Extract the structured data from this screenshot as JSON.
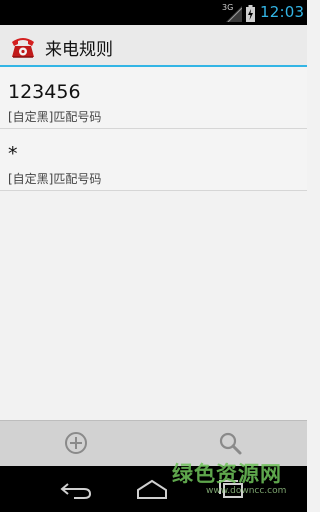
{
  "status_bar": {
    "network": "3G",
    "time": "12:03",
    "accent_color": "#33b5e5"
  },
  "action_bar": {
    "title": "来电规则",
    "icon": "red-telephone-icon"
  },
  "rules": [
    {
      "number": "123456",
      "description": "[自定黑]匹配号码"
    },
    {
      "number": "*",
      "description": "[自定黑]匹配号码"
    }
  ],
  "toolbar": {
    "add_icon": "add-circle-icon",
    "search_icon": "search-icon"
  },
  "nav_bar": {
    "back_icon": "back-icon",
    "home_icon": "home-icon",
    "recents_icon": "recents-icon"
  },
  "watermark": {
    "text": "绿色资源网",
    "subtext": "www.downcc.com"
  }
}
